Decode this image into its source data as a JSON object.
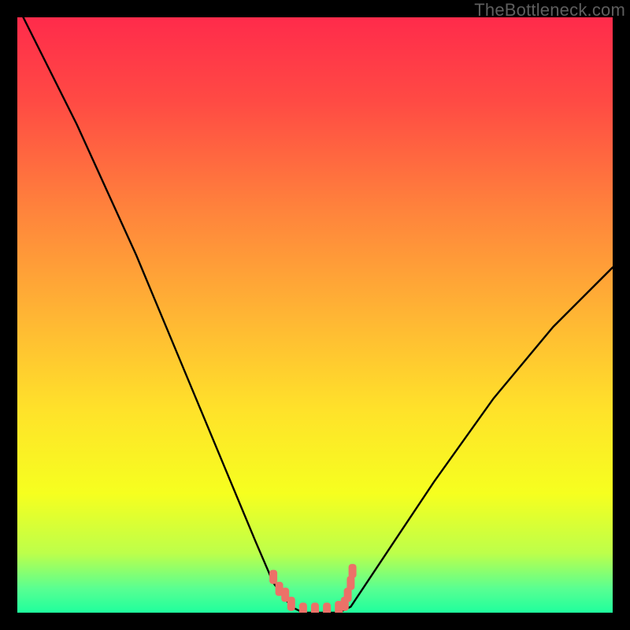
{
  "watermark": "TheBottleneck.com",
  "colors": {
    "bg_black": "#000000",
    "curve": "#000000",
    "marker": "#d76a63",
    "marker_fill": "#ec7168",
    "gradient_stops": [
      "#ff2b4b",
      "#ff4a44",
      "#ff823c",
      "#ffb534",
      "#ffe22a",
      "#f6ff1f",
      "#bdff4a",
      "#58ff92",
      "#1fff9d"
    ]
  },
  "chart_data": {
    "type": "line",
    "title": "",
    "xlabel": "",
    "ylabel": "",
    "x": [
      0,
      5,
      10,
      15,
      20,
      25,
      30,
      35,
      40,
      43,
      46,
      48,
      50,
      52,
      54,
      56,
      58,
      62,
      70,
      80,
      90,
      100
    ],
    "values": [
      102,
      92,
      82,
      71,
      60,
      48,
      36,
      24,
      12,
      5,
      1,
      0,
      0,
      0,
      0,
      1,
      4,
      10,
      22,
      36,
      48,
      58
    ],
    "xlim": [
      0,
      100
    ],
    "ylim": [
      0,
      100
    ],
    "markers": {
      "x": [
        43,
        44,
        45,
        46,
        48,
        50,
        52,
        54,
        55,
        55.5,
        56,
        56.3
      ],
      "y": [
        6,
        4,
        3,
        1.5,
        0.5,
        0.5,
        0.5,
        0.8,
        1.5,
        3,
        5,
        7
      ]
    }
  }
}
